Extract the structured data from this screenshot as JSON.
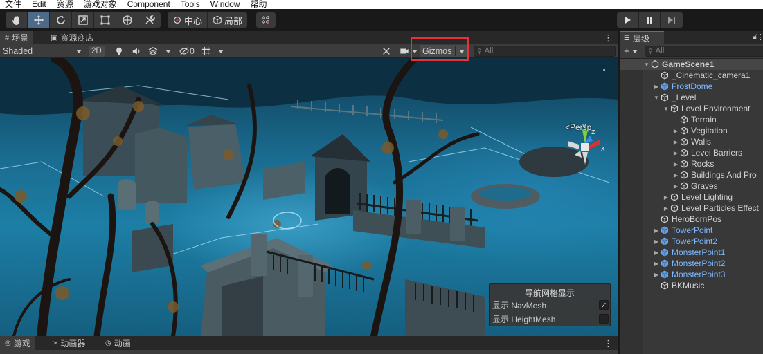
{
  "menubar": {
    "items": [
      "文件",
      "Edit",
      "资源",
      "游戏对象",
      "Component",
      "Tools",
      "Window",
      "帮助"
    ]
  },
  "toolbar": {
    "tools": [
      "hand-tool",
      "move-tool",
      "rotate-tool",
      "scale-tool",
      "rect-tool",
      "transform-tool",
      "custom-tool"
    ],
    "pivot_label": "中心",
    "space_label": "局部"
  },
  "scene_tabs": {
    "scene_label": "场景",
    "store_label": "资源商店"
  },
  "scene_toolbar": {
    "shading_mode": "Shaded",
    "mode_2d": "2D",
    "hidden_count": "0",
    "gizmos_label": "Gizmos",
    "search_placeholder": "All"
  },
  "viewport": {
    "projection_label": "<Persp",
    "axis_x": "x",
    "axis_y": "y",
    "axis_z": "z"
  },
  "nav_overlay": {
    "title": "导航网格显示",
    "rows": [
      {
        "label": "显示 NavMesh",
        "checked": "✓"
      },
      {
        "label": "显示 HeightMesh",
        "checked": ""
      }
    ]
  },
  "bottom_tabs": {
    "game_label": "游戏",
    "animator_label": "动画器",
    "animation_label": "动画"
  },
  "hierarchy": {
    "tab_label": "层级",
    "search_placeholder": "All",
    "scene_name": "GameScene1",
    "items": [
      {
        "label": "_Cinematic_camera1",
        "depth": 1,
        "arrow": "",
        "prefab": false
      },
      {
        "label": "FrostDome",
        "depth": 1,
        "arrow": "▶",
        "prefab": true
      },
      {
        "label": "_Level",
        "depth": 1,
        "arrow": "▼",
        "prefab": false
      },
      {
        "label": "Level Environment",
        "depth": 2,
        "arrow": "▼",
        "prefab": false
      },
      {
        "label": "Terrain",
        "depth": 3,
        "arrow": "",
        "prefab": false
      },
      {
        "label": "Vegitation",
        "depth": 3,
        "arrow": "▶",
        "prefab": false
      },
      {
        "label": "Walls",
        "depth": 3,
        "arrow": "▶",
        "prefab": false
      },
      {
        "label": "Level Barriers",
        "depth": 3,
        "arrow": "▶",
        "prefab": false
      },
      {
        "label": "Rocks",
        "depth": 3,
        "arrow": "▶",
        "prefab": false
      },
      {
        "label": "Buildings And Pro",
        "depth": 3,
        "arrow": "▶",
        "prefab": false
      },
      {
        "label": "Graves",
        "depth": 3,
        "arrow": "▶",
        "prefab": false
      },
      {
        "label": "Level Lighting",
        "depth": 2,
        "arrow": "▶",
        "prefab": false
      },
      {
        "label": "Level Particles Effect",
        "depth": 2,
        "arrow": "▶",
        "prefab": false
      },
      {
        "label": "HeroBornPos",
        "depth": 1,
        "arrow": "",
        "prefab": false
      },
      {
        "label": "TowerPoint",
        "depth": 1,
        "arrow": "▶",
        "prefab": true
      },
      {
        "label": "TowerPoint2",
        "depth": 1,
        "arrow": "▶",
        "prefab": true
      },
      {
        "label": "MonsterPoint1",
        "depth": 1,
        "arrow": "▶",
        "prefab": true
      },
      {
        "label": "MonsterPoint2",
        "depth": 1,
        "arrow": "▶",
        "prefab": true
      },
      {
        "label": "MonsterPoint3",
        "depth": 1,
        "arrow": "▶",
        "prefab": true
      },
      {
        "label": "BKMusic",
        "depth": 1,
        "arrow": "",
        "prefab": false
      }
    ]
  },
  "colors": {
    "accent": "#3a79bb",
    "prefab_text": "#7cb8ff",
    "highlight_box": "#e5333a"
  }
}
